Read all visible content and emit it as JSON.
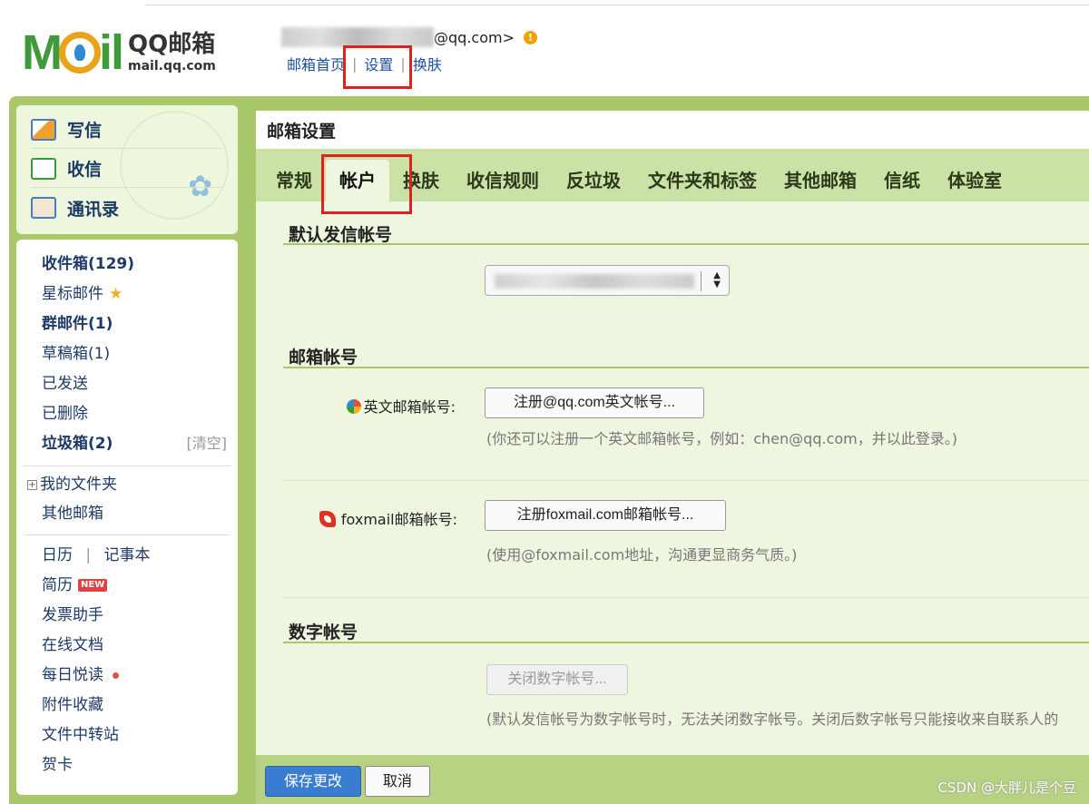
{
  "header": {
    "logo_brand": "MOil",
    "logo_product": "QQ邮箱",
    "logo_url": "mail.qq.com",
    "email_suffix": "@qq.com>",
    "warn_icon": "!",
    "nav": [
      "邮箱首页",
      "设置",
      "换肤"
    ],
    "nav_sep": "|"
  },
  "quick_actions": [
    {
      "label": "写信",
      "icon": "compose-icon"
    },
    {
      "label": "收信",
      "icon": "inbox-icon"
    },
    {
      "label": "通讯录",
      "icon": "contacts-icon"
    }
  ],
  "folders": [
    {
      "label": "收件箱(129)",
      "bold": true
    },
    {
      "label": "星标邮件",
      "bold": false,
      "star": "★"
    },
    {
      "label": "群邮件(1)",
      "bold": true
    },
    {
      "label": "草稿箱(1)",
      "bold": false
    },
    {
      "label": "已发送",
      "bold": false
    },
    {
      "label": "已删除",
      "bold": false
    },
    {
      "label": "垃圾箱(2)",
      "bold": true,
      "action": "[清空]"
    }
  ],
  "my_folders": {
    "expand": "+",
    "label": "我的文件夹"
  },
  "other_mailbox": "其他邮箱",
  "tools": {
    "calendar": "日历",
    "sep": "|",
    "notes": "记事本",
    "resume": "简历",
    "new_badge": "NEW",
    "invoice": "发票助手",
    "docs": "在线文档",
    "daily": "每日悦读",
    "attachments": "附件收藏",
    "transfer": "文件中转站",
    "cards": "贺卡"
  },
  "content": {
    "title": "邮箱设置",
    "tabs": [
      "常规",
      "帐户",
      "换肤",
      "收信规则",
      "反垃圾",
      "文件夹和标签",
      "其他邮箱",
      "信纸",
      "体验室"
    ],
    "active_tab": "帐户",
    "default_sender_title": "默认发信帐号",
    "mailbox_account_title": "邮箱帐号",
    "english_label": "英文邮箱帐号:",
    "english_button": "注册@qq.com英文帐号...",
    "english_hint": "(你还可以注册一个英文邮箱帐号，例如：chen@qq.com，并以此登录。)",
    "foxmail_label": "foxmail邮箱帐号:",
    "foxmail_button": "注册foxmail.com邮箱帐号...",
    "foxmail_hint": "(使用@foxmail.com地址，沟通更显商务气质。)",
    "numeric_title": "数字帐号",
    "numeric_button": "关闭数字帐号...",
    "numeric_hint": "(默认发信帐号为数字帐号时，无法关闭数字帐号。关闭后数字帐号只能接收来自联系人的",
    "save_button": "保存更改",
    "cancel_button": "取消"
  },
  "watermark": "CSDN @大胖儿是个豆",
  "colors": {
    "frame_green": "#a9c76b",
    "tab_bar": "#cbe1a6",
    "content_bg": "#eef6df",
    "link_blue": "#1e50a2",
    "highlight_red": "#e02020",
    "save_blue": "#3a7dd0"
  }
}
